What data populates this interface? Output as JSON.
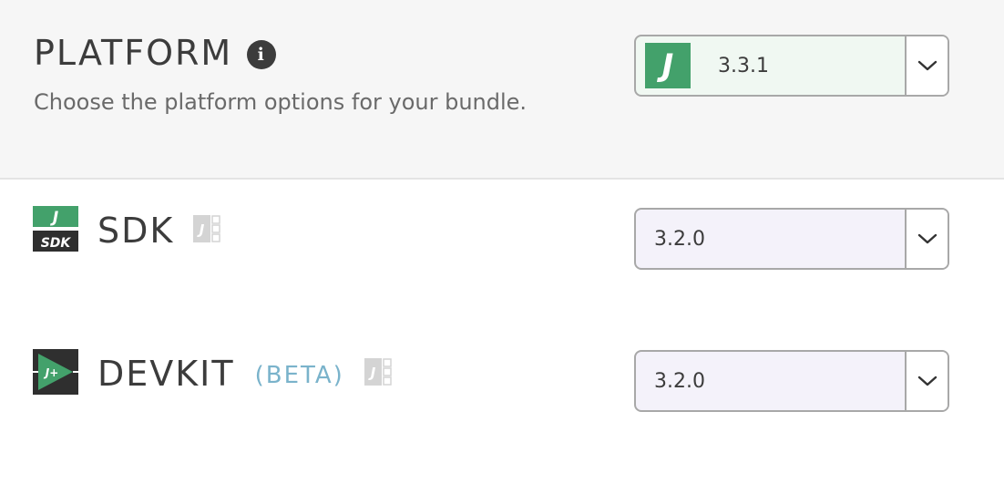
{
  "platform": {
    "title": "PLATFORM",
    "description": "Choose the platform options for your bundle.",
    "selected_version": "3.3.1",
    "badge_letter": "J",
    "badge_color": "#43a16b"
  },
  "sdk": {
    "title": "SDK",
    "icon_top_letter": "J",
    "icon_bottom_text": "SDK",
    "selected_version": "3.2.0"
  },
  "devkit": {
    "title": "DEVKIT",
    "badge": "(BETA)",
    "icon_text": "J+",
    "selected_version": "3.2.0"
  },
  "icons": {
    "info": "info-icon",
    "docs": "docs-icon",
    "dropdown": "chevron-down-icon"
  },
  "colors": {
    "accent_green": "#43a16b",
    "beta_blue": "#7ab3cb"
  }
}
